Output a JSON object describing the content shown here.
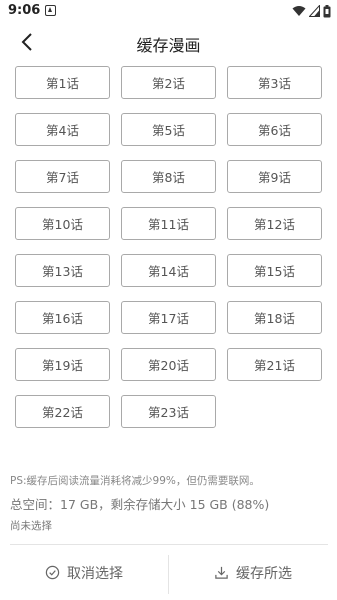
{
  "status_bar": {
    "time": "9:06",
    "icons": [
      "notification-icon",
      "wifi-icon",
      "signal-icon",
      "battery-icon"
    ]
  },
  "nav": {
    "title": "缓存漫画",
    "back_icon": "chevron-left-icon"
  },
  "chapters": [
    "第1话",
    "第2话",
    "第3话",
    "第4话",
    "第5话",
    "第6话",
    "第7话",
    "第8话",
    "第9话",
    "第10话",
    "第11话",
    "第12话",
    "第13话",
    "第14话",
    "第15话",
    "第16话",
    "第17话",
    "第18话",
    "第19话",
    "第20话",
    "第21话",
    "第22话",
    "第23话"
  ],
  "info": {
    "ps": "PS:缓存后阅读流量消耗将减少99%，但仍需要联网。",
    "space": "总空间：17 GB，剩余存储大小 15 GB (88%)",
    "selection": "尚未选择"
  },
  "bottom": {
    "cancel_label": "取消选择",
    "cache_label": "缓存所选",
    "cancel_icon": "check-circle-icon",
    "cache_icon": "download-icon"
  },
  "colors": {
    "border": "#a9a9a9",
    "text": "#555555",
    "muted": "#888888"
  }
}
